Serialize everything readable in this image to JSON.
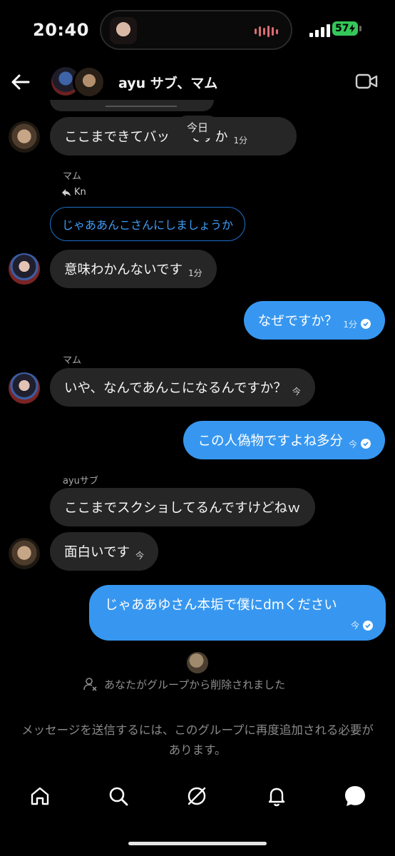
{
  "status_bar": {
    "time": "20:40",
    "battery": "57",
    "battery_color": "#34c759"
  },
  "header": {
    "title": "ayu サブ、マム",
    "back_icon": "arrow-left-icon",
    "video_icon": "video-call-icon"
  },
  "chat": {
    "date_divider": "今日",
    "messages": [
      {
        "sender": "mamu",
        "text": "ここまできてバッ",
        "time": "1分"
      },
      {
        "sender_label": "マム",
        "reply_to": "Kn",
        "quoted": "じゃああんこさんにしましょうか"
      },
      {
        "sender": "ayu",
        "text": "意味わかんないです",
        "time": "1分"
      },
      {
        "sender": "me",
        "text": "なぜですか？",
        "time": "1分"
      },
      {
        "sender_label": "マム"
      },
      {
        "sender": "ayu",
        "text": "いや、なんであんこになるんですか？",
        "time": "今"
      },
      {
        "sender": "me",
        "text": "この人偽物ですよね多分",
        "time": "今"
      },
      {
        "sender_label": "ayuサブ"
      },
      {
        "sender": "ayu",
        "text": "ここまでスクショしてるんですけどねｗ"
      },
      {
        "sender": "mamu",
        "text": "面白いです",
        "time": "今"
      },
      {
        "sender": "me",
        "text": "じゃああゆさん本垢で僕にdmください",
        "time": "今"
      }
    ],
    "covered_tail": "ですか"
  },
  "system": {
    "removed_text": "あなたがグループから削除されました",
    "notice_text": "メッセージを送信するには、このグループに再度追加される必要があります。"
  },
  "nav": {
    "items": [
      "home-icon",
      "search-icon",
      "explore-icon",
      "notifications-icon",
      "messages-icon"
    ]
  },
  "colors": {
    "my_bubble": "#3797f0",
    "their_bubble": "#262626",
    "background": "#000000"
  }
}
